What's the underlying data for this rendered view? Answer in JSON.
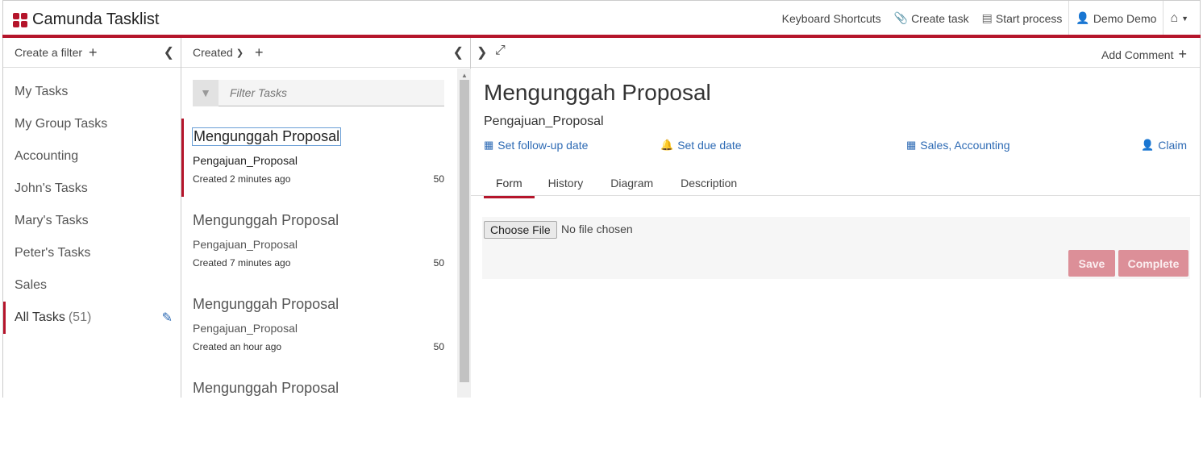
{
  "app": {
    "title": "Camunda Tasklist"
  },
  "topnav": {
    "keyboard_shortcuts": "Keyboard Shortcuts",
    "create_task": "Create task",
    "start_process": "Start process",
    "user": "Demo Demo"
  },
  "filters_panel": {
    "create_filter": "Create a filter",
    "items": [
      {
        "label": "My Tasks"
      },
      {
        "label": "My Group Tasks"
      },
      {
        "label": "Accounting"
      },
      {
        "label": "John's Tasks"
      },
      {
        "label": "Mary's Tasks"
      },
      {
        "label": "Peter's Tasks"
      },
      {
        "label": "Sales"
      },
      {
        "label": "All Tasks",
        "count": "(51)"
      }
    ]
  },
  "task_list": {
    "sort_label": "Created",
    "filter_placeholder": "Filter Tasks",
    "tasks": [
      {
        "name": "Mengunggah Proposal",
        "process": "Pengajuan_Proposal",
        "created": "Created 2 minutes ago",
        "priority": "50"
      },
      {
        "name": "Mengunggah Proposal",
        "process": "Pengajuan_Proposal",
        "created": "Created 7 minutes ago",
        "priority": "50"
      },
      {
        "name": "Mengunggah Proposal",
        "process": "Pengajuan_Proposal",
        "created": "Created an hour ago",
        "priority": "50"
      },
      {
        "name": "Mengunggah Proposal",
        "process": "",
        "created": "",
        "priority": ""
      }
    ]
  },
  "detail": {
    "add_comment": "Add Comment",
    "title": "Mengunggah Proposal",
    "process": "Pengajuan_Proposal",
    "follow_up": "Set follow-up date",
    "due_date": "Set due date",
    "groups": "Sales, Accounting",
    "claim": "Claim",
    "tabs": [
      "Form",
      "History",
      "Diagram",
      "Description"
    ],
    "form": {
      "choose_file": "Choose File",
      "file_status": "No file chosen",
      "save": "Save",
      "complete": "Complete"
    }
  },
  "colors": {
    "accent": "#b5152b",
    "link": "#2d6ab4",
    "button_disabled": "#dc8f98"
  },
  "icons": [
    "camunda-logo-icon",
    "paperclip-icon",
    "list-icon",
    "user-icon",
    "home-icon",
    "chevron-left-icon",
    "chevron-right-icon",
    "expand-icon",
    "funnel-icon",
    "pencil-icon",
    "calendar-icon",
    "bell-icon",
    "grid-icon"
  ]
}
